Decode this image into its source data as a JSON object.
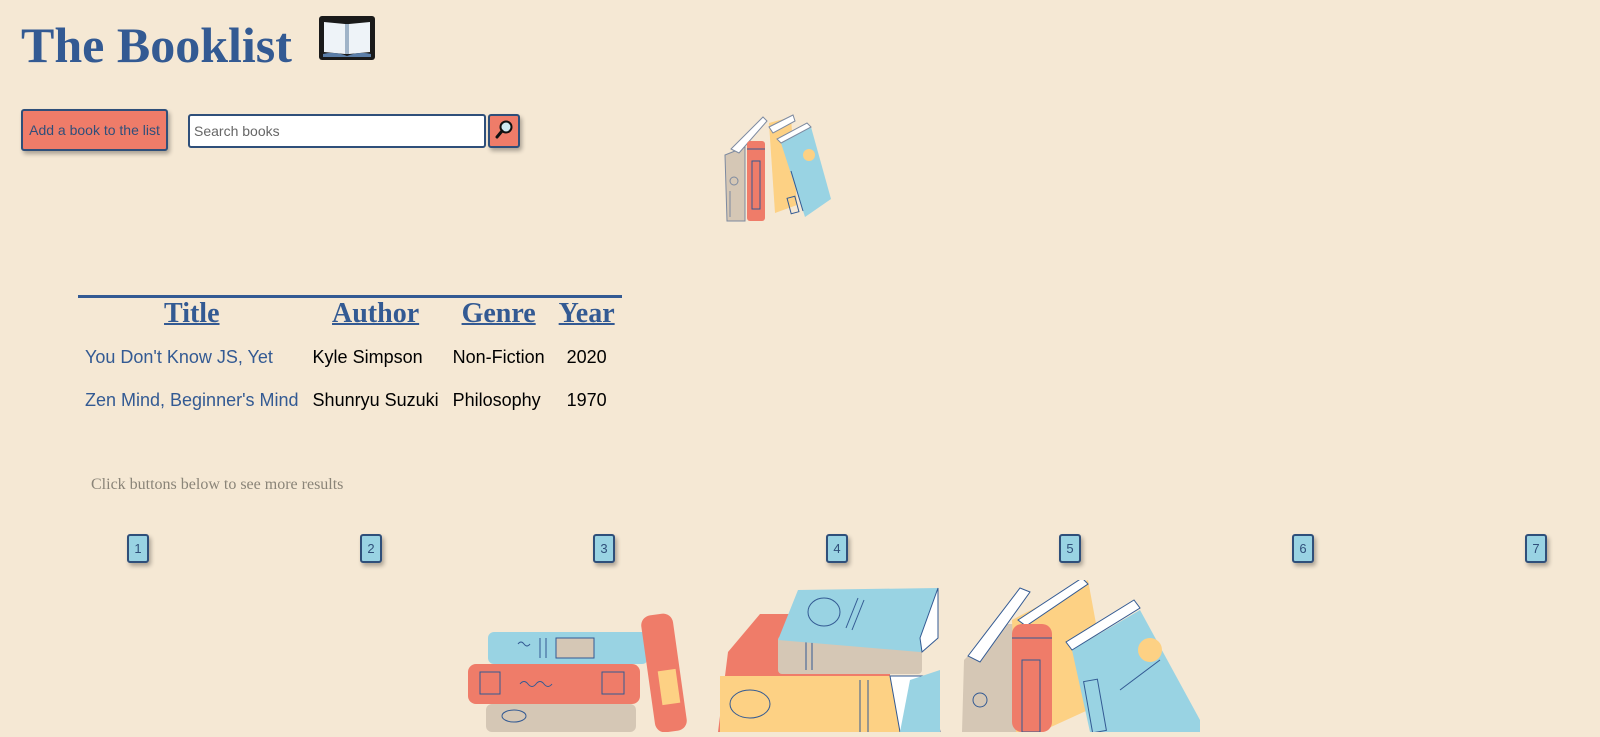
{
  "header": {
    "title": "The Booklist",
    "icon": "open-book-icon"
  },
  "toolbar": {
    "add_label": "Add a book to the list",
    "search_placeholder": "Search books",
    "search_value": "",
    "search_icon": "magnifier-icon"
  },
  "table": {
    "headers": [
      "Title",
      "Author",
      "Genre",
      "Year"
    ],
    "rows": [
      {
        "title": "You Don't Know JS, Yet",
        "author": "Kyle Simpson",
        "genre": "Non-Fiction",
        "year": "2020"
      },
      {
        "title": "Zen Mind, Beginner's Mind",
        "author": "Shunryu Suzuki",
        "genre": "Philosophy",
        "year": "1970"
      }
    ]
  },
  "pagination": {
    "hint": "Click buttons below to see more results",
    "pages": [
      "1",
      "2",
      "3",
      "4",
      "5",
      "6",
      "7"
    ]
  },
  "colors": {
    "background": "#f5e8d4",
    "primary_blue": "#335a93",
    "coral": "#ef7c69",
    "light_blue": "#99d3e3",
    "yellow": "#fdd184",
    "tan": "#d5c7b5"
  }
}
